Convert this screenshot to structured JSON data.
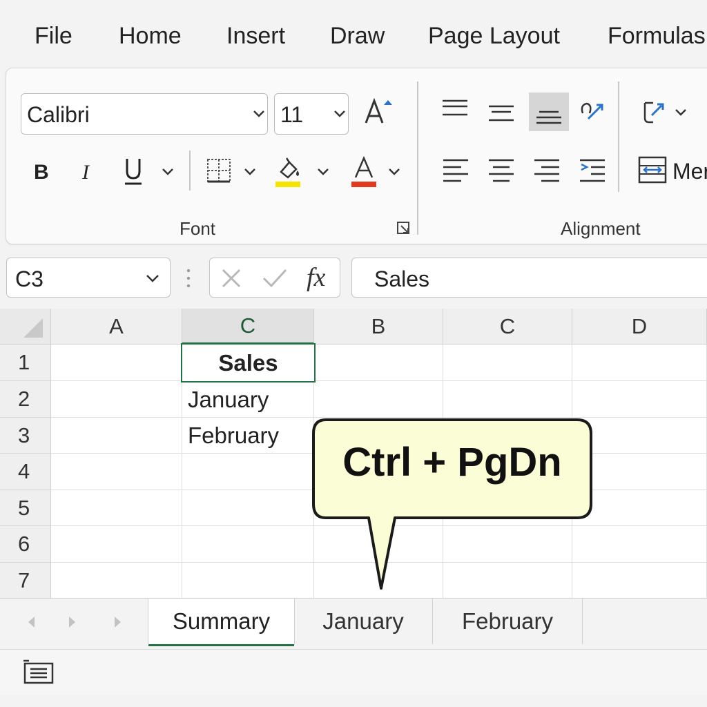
{
  "menu": {
    "tabs": [
      "File",
      "Home",
      "Insert",
      "Draw",
      "Page Layout",
      "Formulas"
    ]
  },
  "ribbon": {
    "font": {
      "name": "Calibri",
      "size": "11",
      "label": "Font",
      "highlight_color": "#f5e400",
      "font_color": "#e23a1f"
    },
    "alignment": {
      "label": "Alignment",
      "merge_label": "Merge"
    }
  },
  "formula_bar": {
    "name_box": "C3",
    "fx": "fx",
    "content": "Sales"
  },
  "grid": {
    "columns": [
      "A",
      "C",
      "B",
      "C",
      "D"
    ],
    "rows": [
      "1",
      "2",
      "3",
      "4",
      "5",
      "6",
      "7"
    ],
    "cells": {
      "c1": "Sales",
      "c2": "January",
      "c3": "February"
    }
  },
  "callout": {
    "text": "Ctrl + PgDn",
    "bg_color": "#fafdd6"
  },
  "sheets": {
    "tabs": [
      "Summary",
      "January",
      "February"
    ],
    "active": "Summary",
    "accent": "#217346"
  }
}
